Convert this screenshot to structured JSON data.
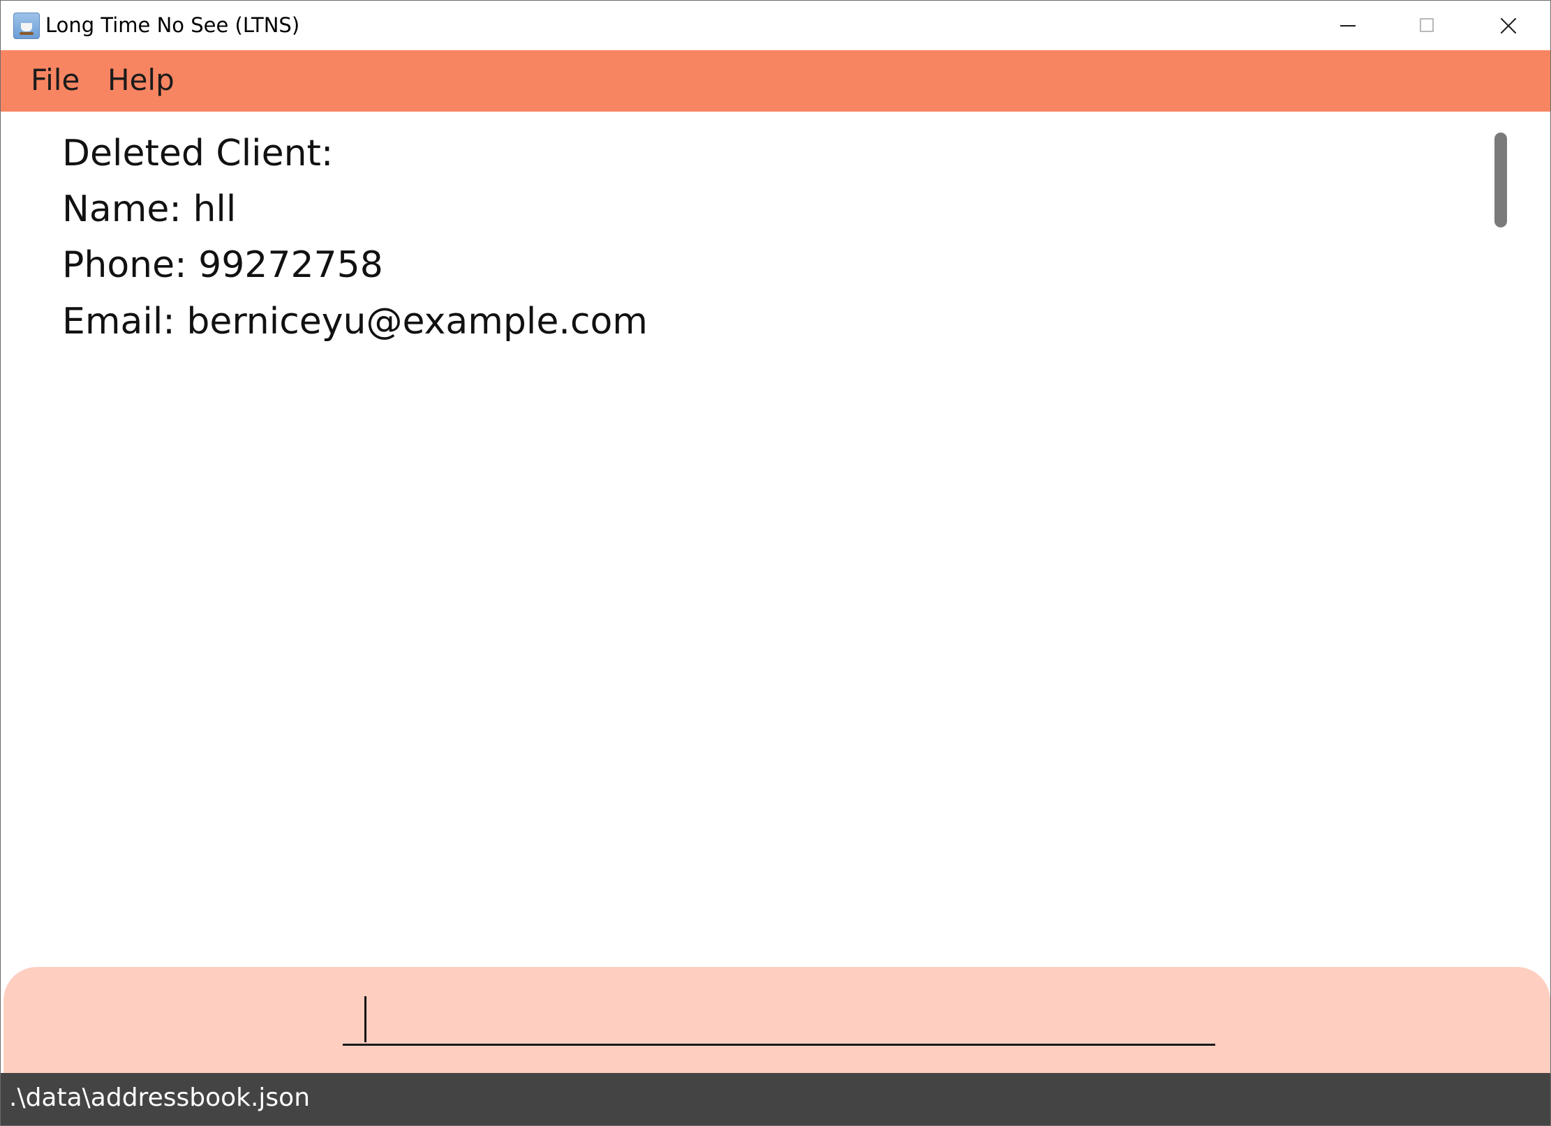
{
  "window": {
    "title": "Long Time No See (LTNS)",
    "icon": "java-coffee-cup-icon",
    "controls": [
      "minimize-icon",
      "maximize-icon",
      "close-icon"
    ]
  },
  "menu": {
    "items": [
      {
        "label": "File"
      },
      {
        "label": "Help"
      }
    ]
  },
  "result": {
    "lines": [
      "Deleted Client:",
      "Name: hll",
      "Phone: 99272758",
      "Email: berniceyu@example.com"
    ]
  },
  "command": {
    "value": "",
    "placeholder": ""
  },
  "status": {
    "path": ".\\data\\addressbook.json"
  },
  "colors": {
    "menubar": "#f88562",
    "command_panel": "#fecfc1",
    "statusbar": "#444444",
    "scrollbar": "#7a7a7a"
  }
}
